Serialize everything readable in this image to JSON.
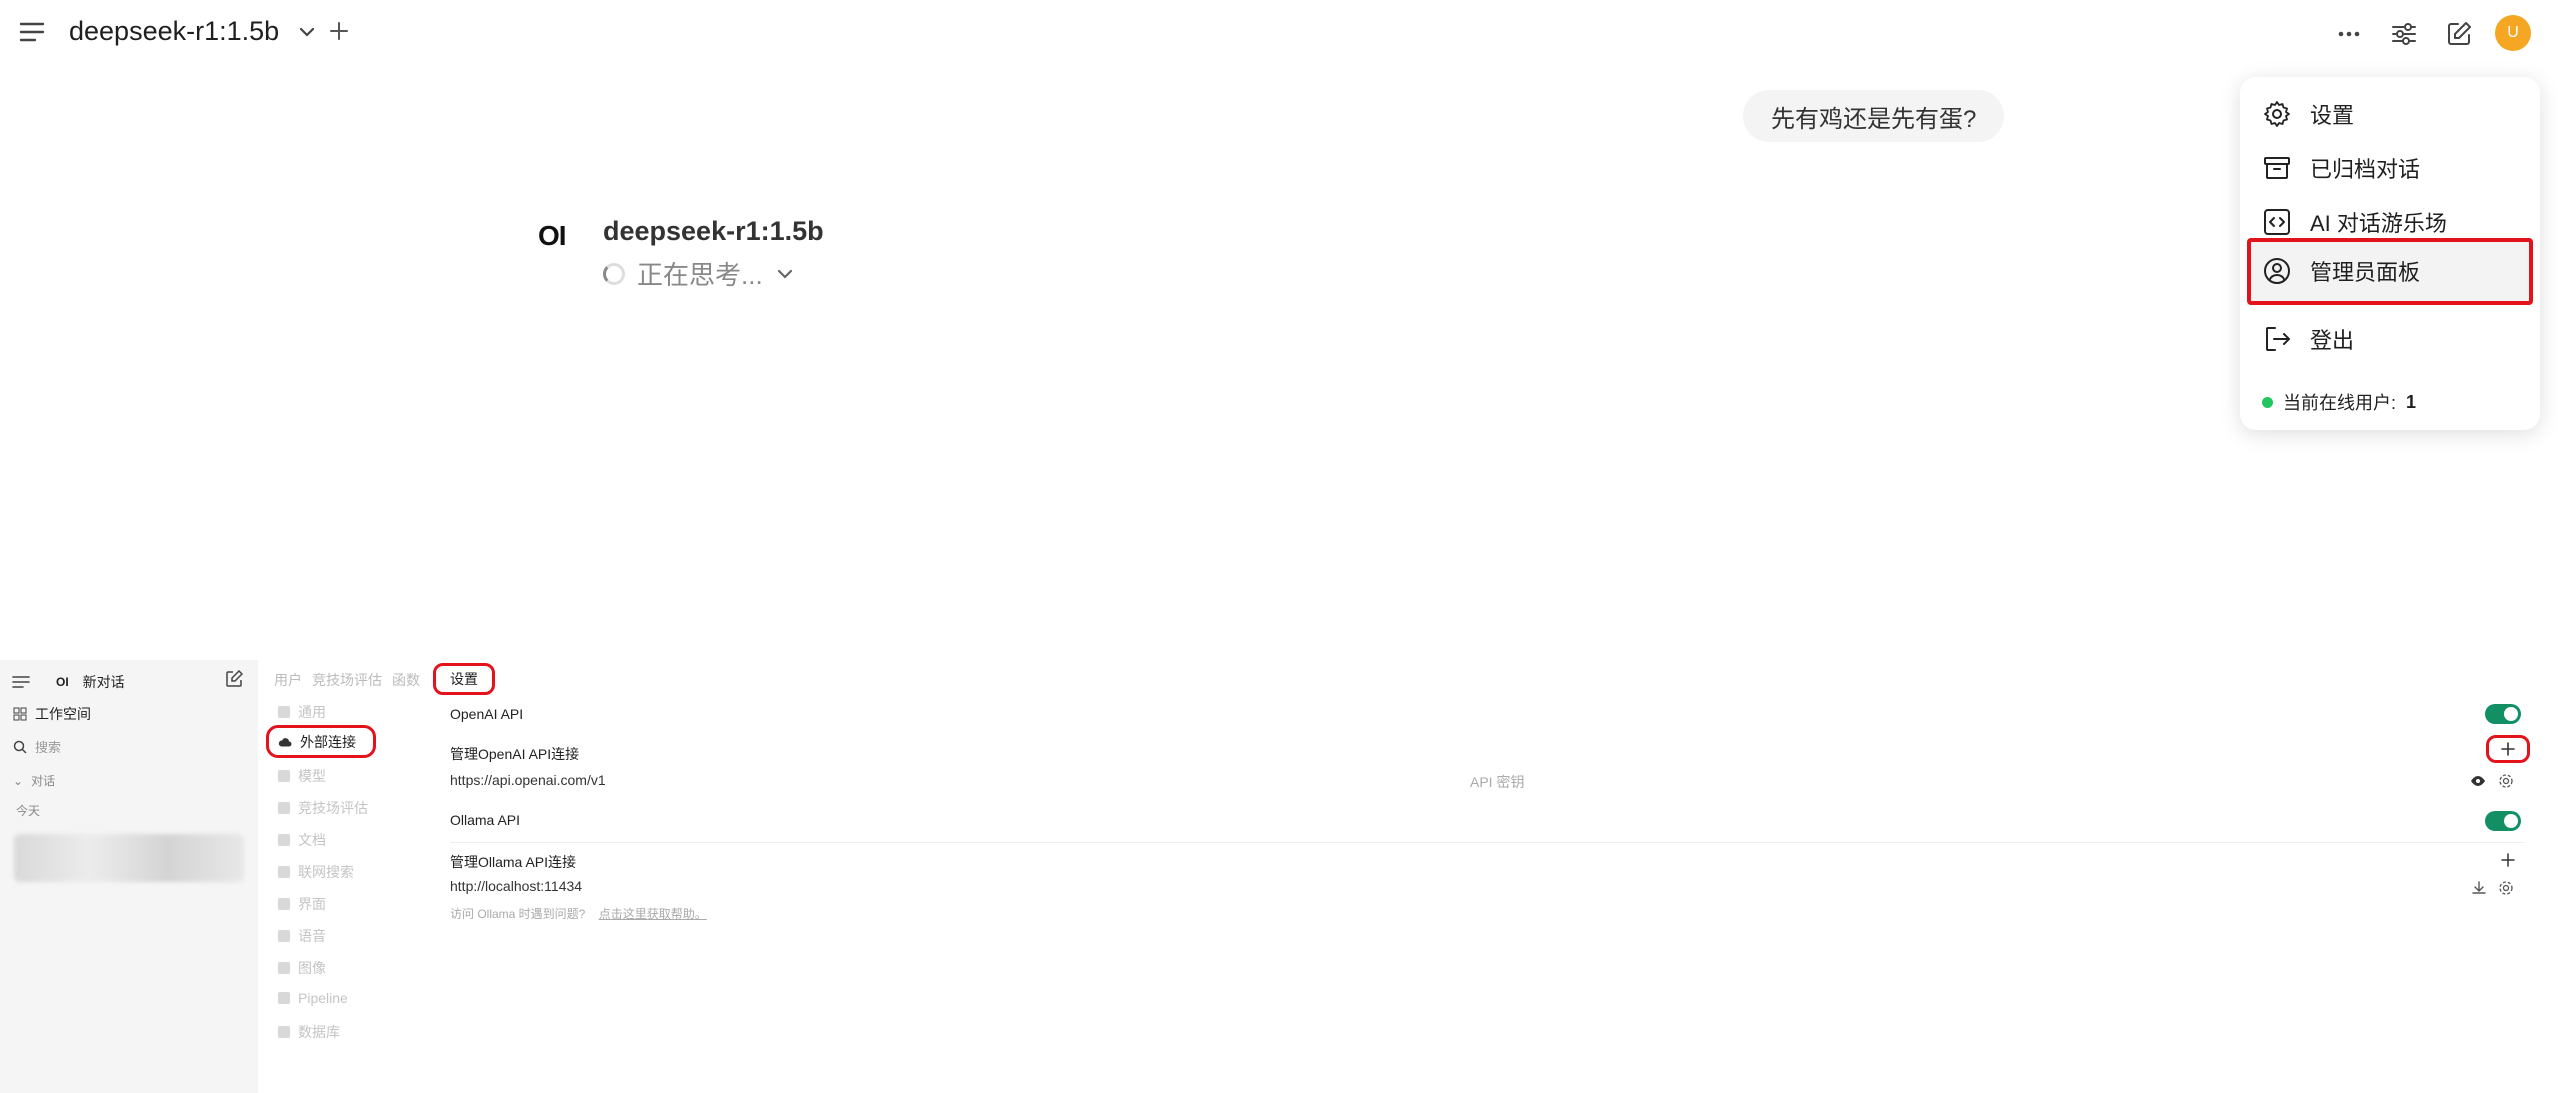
{
  "topbar": {
    "model_name": "deepseek-r1:1.5b",
    "avatar_initial": "U"
  },
  "chat": {
    "user_message": "先有鸡还是先有蛋?",
    "bot_logo": "OI",
    "bot_name": "deepseek-r1:1.5b",
    "thinking_text": "正在思考..."
  },
  "dropdown": {
    "items": [
      {
        "label": "设置",
        "icon": "gear-icon"
      },
      {
        "label": "已归档对话",
        "icon": "archive-icon"
      },
      {
        "label": "AI 对话游乐场",
        "icon": "code-icon"
      },
      {
        "label": "管理员面板",
        "icon": "user-circle-icon"
      },
      {
        "label": "登出",
        "icon": "logout-icon"
      }
    ],
    "online_label": "当前在线用户:",
    "online_count": "1"
  },
  "admin": {
    "sidebar": {
      "logo": "OI",
      "new_chat": "新对话",
      "workspace": "工作空间",
      "search_placeholder": "搜索",
      "section": "对话",
      "today": "今天"
    },
    "tabs": [
      "用户",
      "竞技场评估",
      "函数"
    ],
    "active_tab": "设置",
    "nav": {
      "general": "通用",
      "connections": "外部连接",
      "models": "模型",
      "arena": "竞技场评估",
      "documents": "文档",
      "web_search": "联网搜索",
      "interface": "界面",
      "audio": "语音",
      "images": "图像",
      "pipeline": "Pipeline",
      "database": "数据库"
    },
    "content": {
      "openai_title": "OpenAI API",
      "openai_manage": "管理OpenAI API连接",
      "openai_url": "https://api.openai.com/v1",
      "api_key_placeholder": "API 密钥",
      "ollama_title": "Ollama API",
      "ollama_manage": "管理Ollama API连接",
      "ollama_url": "http://localhost:11434",
      "hint": "访问 Ollama 时遇到问题?",
      "hint_link": "点击这里获取帮助。"
    }
  },
  "colors": {
    "highlight_red": "#e3121b",
    "toggle_green": "#129064",
    "avatar_orange": "#f5a623",
    "online_green": "#22c55e"
  }
}
